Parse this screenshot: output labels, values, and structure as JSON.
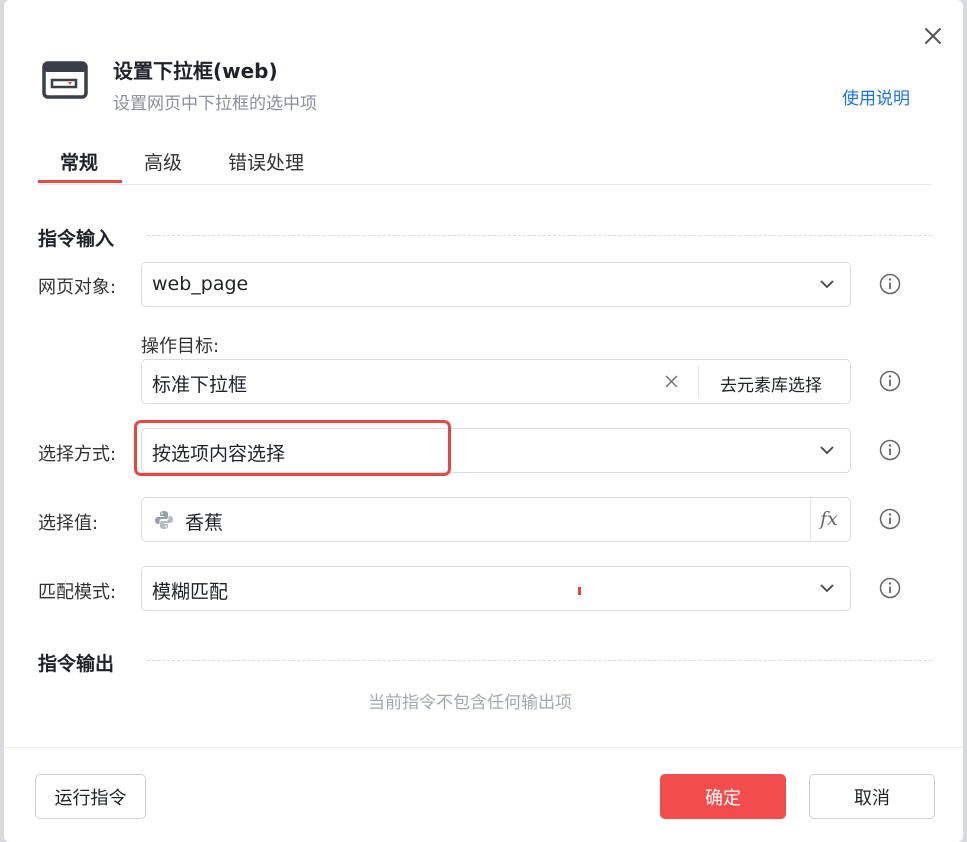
{
  "dialog": {
    "title": "设置下拉框(web)",
    "subtitle": "设置网页中下拉框的选中项",
    "help_link": "使用说明",
    "close_icon": "close-icon",
    "app_icon": "browser-window-icon"
  },
  "tabs": [
    {
      "label": "常规",
      "active": true
    },
    {
      "label": "高级",
      "active": false
    },
    {
      "label": "错误处理",
      "active": false
    }
  ],
  "inputs_section": {
    "title": "指令输入",
    "web_page": {
      "label": "网页对象:",
      "value": "web_page"
    },
    "target": {
      "label": "操作目标:",
      "value": "标准下拉框",
      "library_button": "去元素库选择"
    },
    "select_method": {
      "label": "选择方式:",
      "value": "按选项内容选择"
    },
    "select_value": {
      "label": "选择值:",
      "value": "香蕉",
      "icon": "python-icon",
      "fx_label": "fx"
    },
    "match_mode": {
      "label": "匹配模式:",
      "value": "模糊匹配"
    }
  },
  "outputs_section": {
    "title": "指令输出",
    "empty_text": "当前指令不包含任何输出项"
  },
  "footer": {
    "run_button": "运行指令",
    "confirm_button": "确定",
    "cancel_button": "取消"
  },
  "colors": {
    "accent": "#f24c4c",
    "link": "#1a73e8",
    "highlight_border": "#e84545"
  }
}
